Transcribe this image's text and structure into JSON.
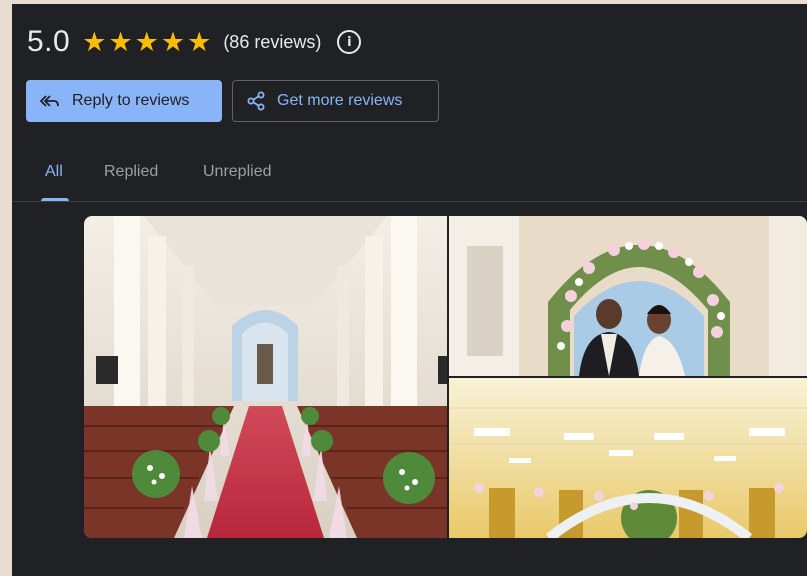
{
  "rating": {
    "score": "5.0",
    "star_count": 5,
    "review_count_text": "(86 reviews)",
    "info_icon": "info-icon"
  },
  "actions": {
    "reply_label": "Reply to reviews",
    "reply_icon": "reply-all-icon",
    "get_more_label": "Get more reviews",
    "get_more_icon": "share-icon"
  },
  "tabs": [
    {
      "label": "All",
      "active": true
    },
    {
      "label": "Replied",
      "active": false
    },
    {
      "label": "Unreplied",
      "active": false
    }
  ],
  "photos": [
    {
      "name": "church-interior-photo"
    },
    {
      "name": "couple-floral-arch-photo"
    },
    {
      "name": "hall-floral-decor-photo"
    }
  ],
  "colors": {
    "panel_bg": "#202124",
    "accent_blue": "#8ab4f8",
    "star_gold": "#fbbc04",
    "text_primary": "#e8eaed",
    "text_secondary": "#9aa0a6"
  }
}
